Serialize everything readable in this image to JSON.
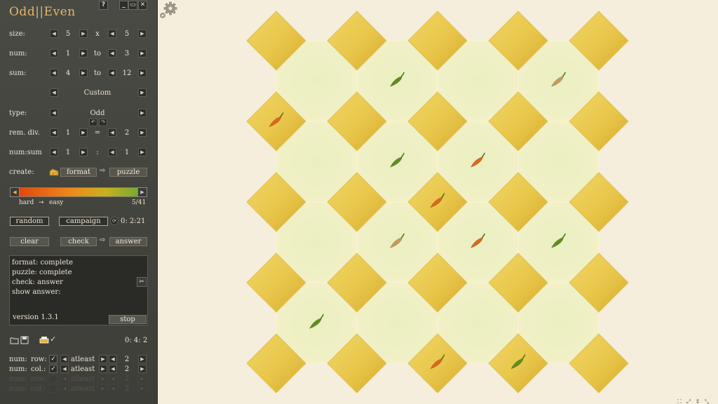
{
  "app": {
    "title": "Odd||Even"
  },
  "window_buttons": {
    "help": "?",
    "minimize": "_",
    "restore": "▭",
    "close": "✕"
  },
  "controls": {
    "size": {
      "label": "size:",
      "a": "5",
      "sep": "x",
      "b": "5"
    },
    "num": {
      "label": "num:",
      "a": "1",
      "sep": "to",
      "b": "3"
    },
    "sum": {
      "label": "sum:",
      "a": "4",
      "sep": "to",
      "b": "12"
    },
    "preset": "Custom",
    "type": {
      "label": "type:",
      "value": "Odd"
    },
    "remdiv": {
      "label": "rem. div.",
      "a": "1",
      "sep": "=",
      "b": "2"
    },
    "numsum": {
      "label": "num:sum",
      "a": "1",
      "sep": ":",
      "b": "1"
    },
    "create": {
      "label": "create:",
      "format": "format",
      "puzzle": "puzzle"
    }
  },
  "difficulty": {
    "hard": "hard",
    "arrow": "→",
    "easy": "easy",
    "count": "5/41",
    "level": 0.0
  },
  "actions": {
    "random": "random",
    "campaign": "campaign",
    "timer": "0: 2:21",
    "clear": "clear",
    "check": "check",
    "answer": "answer"
  },
  "log": {
    "lines": [
      "format: complete",
      "puzzle: complete",
      "check: answer",
      "show answer:"
    ],
    "version": "version 1.3.1",
    "stop": "stop"
  },
  "footer": {
    "timer2": "0: 4: 2"
  },
  "constraints": [
    {
      "label": "num:",
      "sub": "row:",
      "mode": "atleast",
      "value": "2"
    },
    {
      "label": "num:",
      "sub": "col.:",
      "mode": "atleast",
      "value": "2"
    },
    {
      "label": "num:",
      "sub": "row:",
      "mode": "atleast",
      "value": "2"
    },
    {
      "label": "num:",
      "sub": "col.:",
      "mode": "atleast",
      "value": "2"
    }
  ],
  "colors": {
    "panel": "#45453f",
    "diamond": "#e8c64a",
    "octagon": "#eef0c4",
    "pepper_green": "#5e8f1c",
    "pepper_orange": "#e0661c",
    "pepper_tan": "#c99a5a",
    "background": "#f5eedc"
  },
  "board": {
    "grid": 5,
    "peppers": [
      {
        "row": 0,
        "col": 1,
        "kind": "green",
        "on": "octagon"
      },
      {
        "row": 0,
        "col": 3,
        "kind": "tan",
        "on": "octagon"
      },
      {
        "row": 1,
        "col": 0,
        "kind": "orange",
        "on": "diamond"
      },
      {
        "row": 1,
        "col": 1,
        "kind": "green",
        "on": "octagon"
      },
      {
        "row": 1,
        "col": 2,
        "kind": "orange",
        "on": "octagon"
      },
      {
        "row": 2,
        "col": 2,
        "kind": "orange",
        "on": "diamond"
      },
      {
        "row": 2,
        "col": 1,
        "kind": "tan",
        "on": "octagon"
      },
      {
        "row": 2,
        "col": 2,
        "kind": "orange",
        "on": "octagon"
      },
      {
        "row": 2,
        "col": 3,
        "kind": "green",
        "on": "octagon"
      },
      {
        "row": 3,
        "col": 0,
        "kind": "green",
        "on": "octagon"
      },
      {
        "row": 4,
        "col": 2,
        "kind": "orange",
        "on": "diamond"
      },
      {
        "row": 4,
        "col": 3,
        "kind": "green",
        "on": "diamond"
      }
    ]
  }
}
